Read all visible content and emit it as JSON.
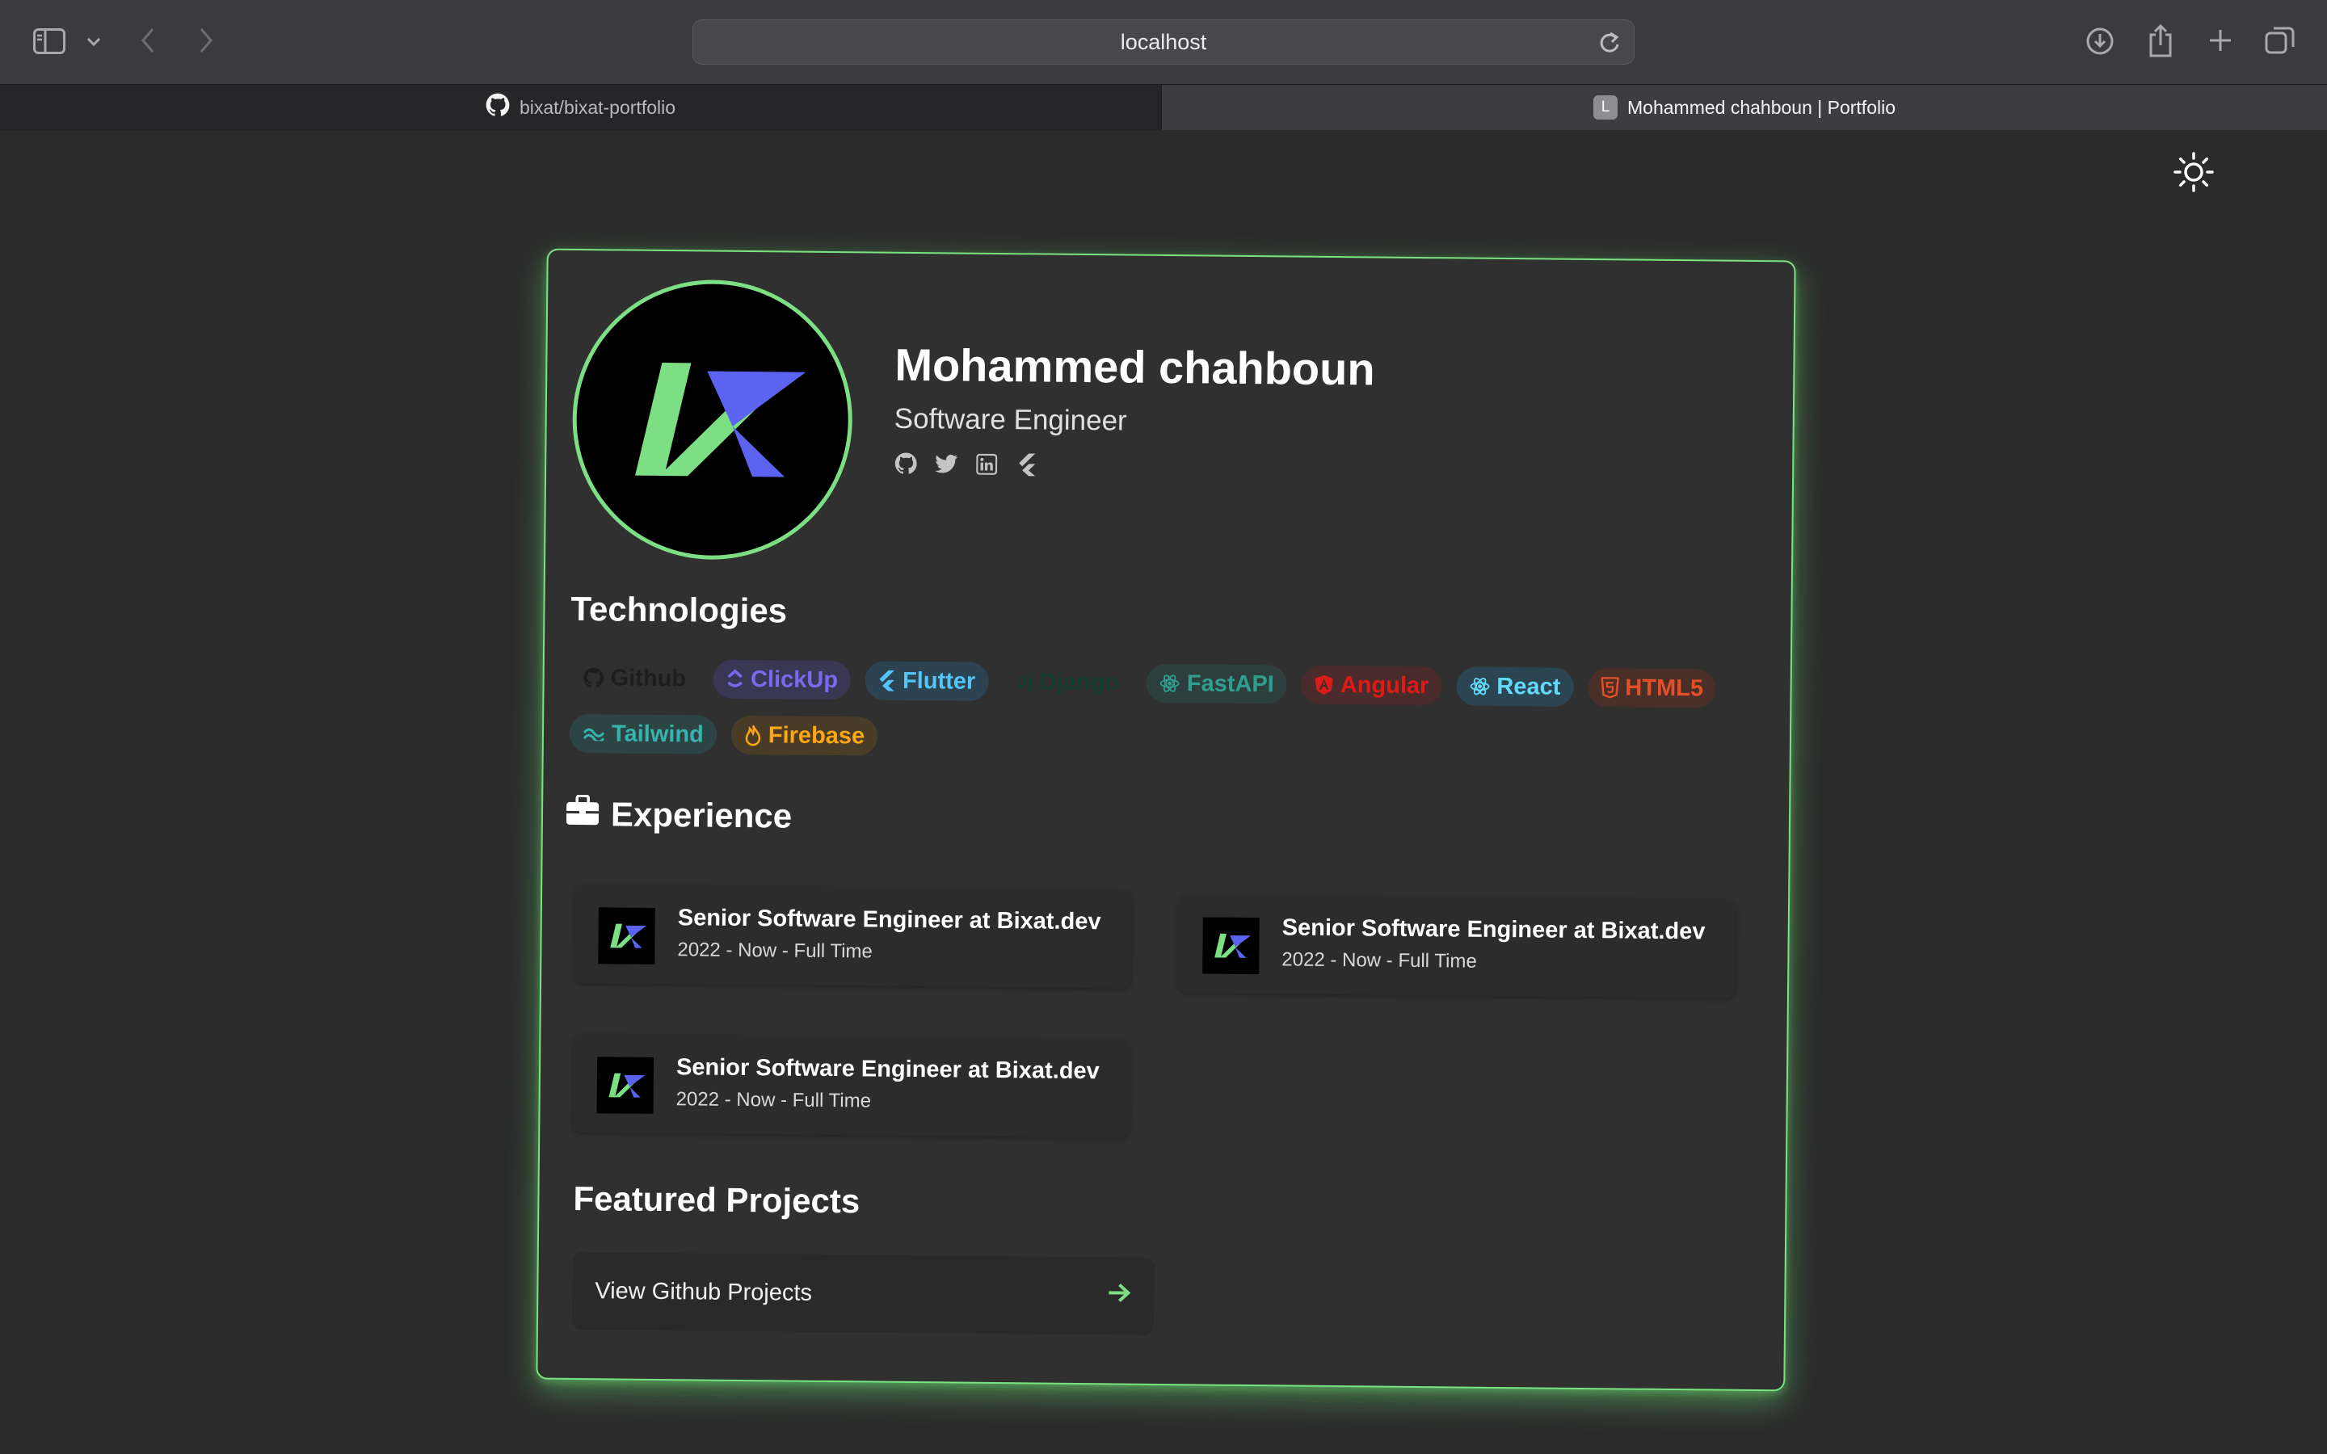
{
  "browser": {
    "url": "localhost",
    "tabs": [
      {
        "title": "bixat/bixat-portfolio",
        "icon": "github-icon"
      },
      {
        "title": "Mohammed chahboun | Portfolio",
        "icon": "L"
      }
    ]
  },
  "profile": {
    "name": "Mohammed chahboun",
    "role": "Software Engineer",
    "socials": [
      "github-icon",
      "twitter-icon",
      "linkedin-icon",
      "flutter-icon"
    ]
  },
  "technologies": {
    "title": "Technologies",
    "items": [
      {
        "label": "Github",
        "color": "#222222"
      },
      {
        "label": "ClickUp",
        "color": "#7b68ee"
      },
      {
        "label": "Flutter",
        "color": "#54c5f8"
      },
      {
        "label": "Django",
        "color": "#0c4b33"
      },
      {
        "label": "FastAPI",
        "color": "#2f9e8f"
      },
      {
        "label": "Angular",
        "color": "#dd1b16"
      },
      {
        "label": "React",
        "color": "#61dafb"
      },
      {
        "label": "HTML5",
        "color": "#e34f26"
      },
      {
        "label": "Tailwind",
        "color": "#38b2ac"
      },
      {
        "label": "Firebase",
        "color": "#ffa611"
      }
    ]
  },
  "experience": {
    "title": "Experience",
    "items": [
      {
        "title": "Senior Software Engineer at Bixat.dev",
        "subtitle": "2022 - Now - Full Time"
      },
      {
        "title": "Senior Software Engineer at Bixat.dev",
        "subtitle": "2022 - Now - Full Time"
      },
      {
        "title": "Senior Software Engineer at Bixat.dev",
        "subtitle": "2022 - Now - Full Time"
      }
    ]
  },
  "projects": {
    "title": "Featured Projects",
    "button_label": "View Github Projects"
  },
  "colors": {
    "accent_green": "#7ddf83",
    "logo_blue": "#5b63f0"
  }
}
